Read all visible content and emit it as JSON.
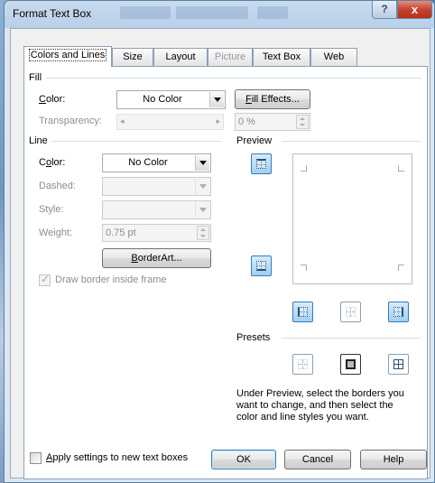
{
  "window": {
    "title": "Format Text Box",
    "help_glyph": "?",
    "close_glyph": "x"
  },
  "tabs": [
    {
      "label": "Colors and Lines",
      "active": true,
      "enabled": true
    },
    {
      "label": "Size",
      "active": false,
      "enabled": true
    },
    {
      "label": "Layout",
      "active": false,
      "enabled": true
    },
    {
      "label": "Picture",
      "active": false,
      "enabled": false
    },
    {
      "label": "Text Box",
      "active": false,
      "enabled": true
    },
    {
      "label": "Web",
      "active": false,
      "enabled": true
    }
  ],
  "fill": {
    "heading": "Fill",
    "color_label_key": "C",
    "color_label_rest": "olor:",
    "color_value": "No Color",
    "fill_effects_key": "F",
    "fill_effects_rest": "ill Effects...",
    "transparency_label": "Transparency:",
    "transparency_left": "◂",
    "transparency_right": "▸",
    "transparency_value": "0 %"
  },
  "line": {
    "heading": "Line",
    "color_label_pre": "C",
    "color_label_key": "o",
    "color_label_rest": "lor:",
    "color_value": "No Color",
    "dashed_label": "Dashed:",
    "style_label": "Style:",
    "weight_label": "Weight:",
    "weight_value": "0.75 pt",
    "borderart_key": "B",
    "borderart_rest": "orderArt...",
    "draw_inside_label": "Draw border inside frame",
    "draw_inside_checked": true
  },
  "preview": {
    "heading": "Preview"
  },
  "presets": {
    "heading": "Presets"
  },
  "help_text": [
    "Under Preview, select the borders you",
    "want to change, and then select the",
    "color and line styles you want."
  ],
  "apply_checkbox": {
    "label_key": "A",
    "label_rest": "pply settings to new text boxes",
    "checked": false
  },
  "footer": {
    "ok": "OK",
    "cancel": "Cancel",
    "help": "Help"
  },
  "colors": {
    "accent": "#3c7fb1",
    "close_red": "#c4432f",
    "panel_bg": "#ffffff",
    "dialog_bg": "#f0f0f0",
    "disabled_text": "#8d8d8d"
  }
}
